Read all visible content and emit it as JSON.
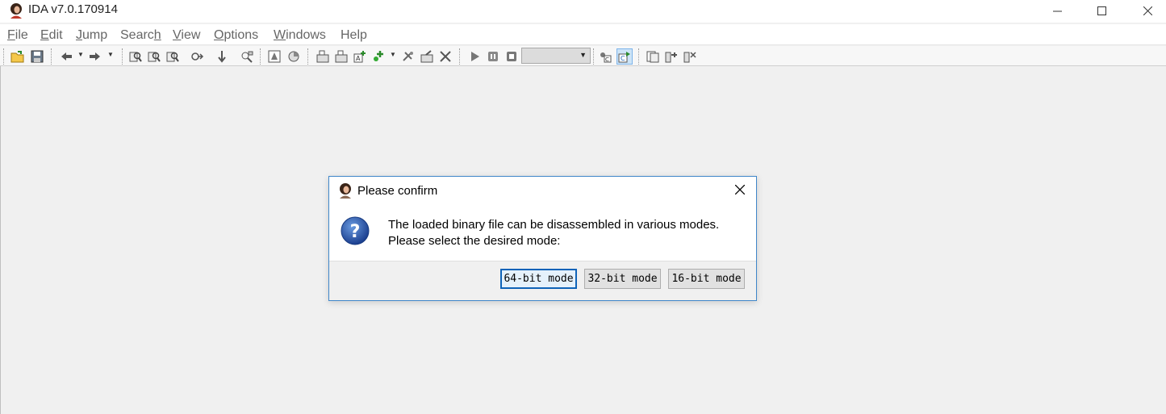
{
  "app": {
    "title": "IDA v7.0.170914"
  },
  "window_controls": {
    "minimize": "—",
    "maximize": "☐",
    "close": "✕"
  },
  "menu": [
    {
      "label": "File",
      "ul": "F",
      "rest": "ile"
    },
    {
      "label": "Edit",
      "ul": "E",
      "rest": "dit"
    },
    {
      "label": "Jump",
      "ul": "J",
      "rest": "ump"
    },
    {
      "label": "Search",
      "pre": "Searc",
      "ul": "h"
    },
    {
      "label": "View",
      "ul": "V",
      "rest": "iew"
    },
    {
      "label": "Options",
      "ul": "O",
      "rest": "ptions"
    },
    {
      "label": "Windows",
      "ul": "W",
      "rest": "indows"
    },
    {
      "label": "Help",
      "ul": "",
      "rest": "Help"
    }
  ],
  "toolbar": {
    "icons": [
      "open-folder-icon",
      "save-icon",
      "back-arrow-icon",
      "forward-arrow-icon",
      "binary-search-icon",
      "text-search-icon",
      "immediate-search-icon",
      "jump-next-icon",
      "jump-down-icon",
      "view-graph-icon",
      "flow-chart-icon",
      "overview-icon",
      "stack-icon",
      "hex-icon",
      "add-segment-icon",
      "add-struct-icon",
      "add-enum-icon",
      "patch-icon",
      "delete-icon",
      "play-icon",
      "pause-icon",
      "stop-icon",
      "debugger-icon",
      "code-c-icon",
      "copy-icon",
      "attach-icon",
      "detach-icon"
    ],
    "debugger_select": ""
  },
  "dialog": {
    "title": "Please confirm",
    "message_line1": "The loaded binary file can be disassembled in various modes.",
    "message_line2": "Please select the desired mode:",
    "buttons": {
      "b64": "64-bit mode",
      "b32": "32-bit mode",
      "b16": "16-bit mode"
    }
  }
}
